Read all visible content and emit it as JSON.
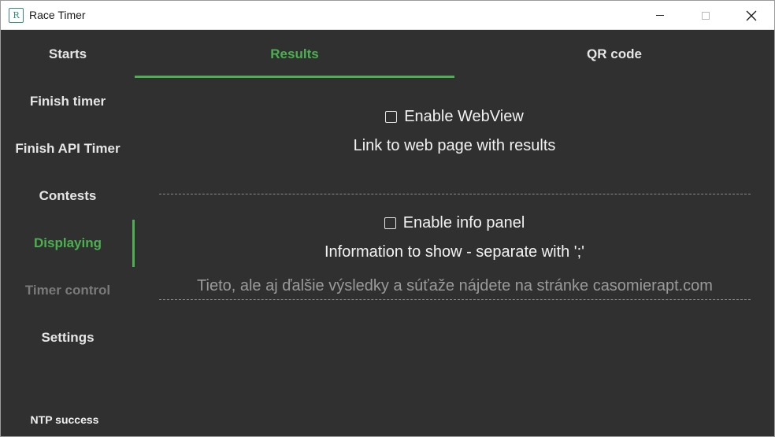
{
  "window": {
    "title": "Race Timer",
    "icon_letter": "R"
  },
  "sidebar": {
    "items": [
      {
        "label": "Starts",
        "state": "normal"
      },
      {
        "label": "Finish timer",
        "state": "normal"
      },
      {
        "label": "Finish API Timer",
        "state": "normal"
      },
      {
        "label": "Contests",
        "state": "normal"
      },
      {
        "label": "Displaying",
        "state": "active"
      },
      {
        "label": "Timer control",
        "state": "disabled"
      },
      {
        "label": "Settings",
        "state": "normal"
      }
    ],
    "status": "NTP success"
  },
  "tabs": [
    {
      "label": "Results",
      "active": true
    },
    {
      "label": "QR code",
      "active": false
    }
  ],
  "results": {
    "webview_checkbox": {
      "label": "Enable WebView",
      "checked": false
    },
    "webview_link_label": "Link to web page with results",
    "info_checkbox": {
      "label": "Enable info panel",
      "checked": false
    },
    "info_label": "Information to show - separate with ';'",
    "info_value": "Tieto, ale aj ďalšie výsledky a súťaže nájdete na stránke casomierapt.com"
  },
  "colors": {
    "accent": "#4caf50",
    "background": "#303030",
    "text": "#f2f2f2",
    "disabled": "#7a7a7a"
  }
}
